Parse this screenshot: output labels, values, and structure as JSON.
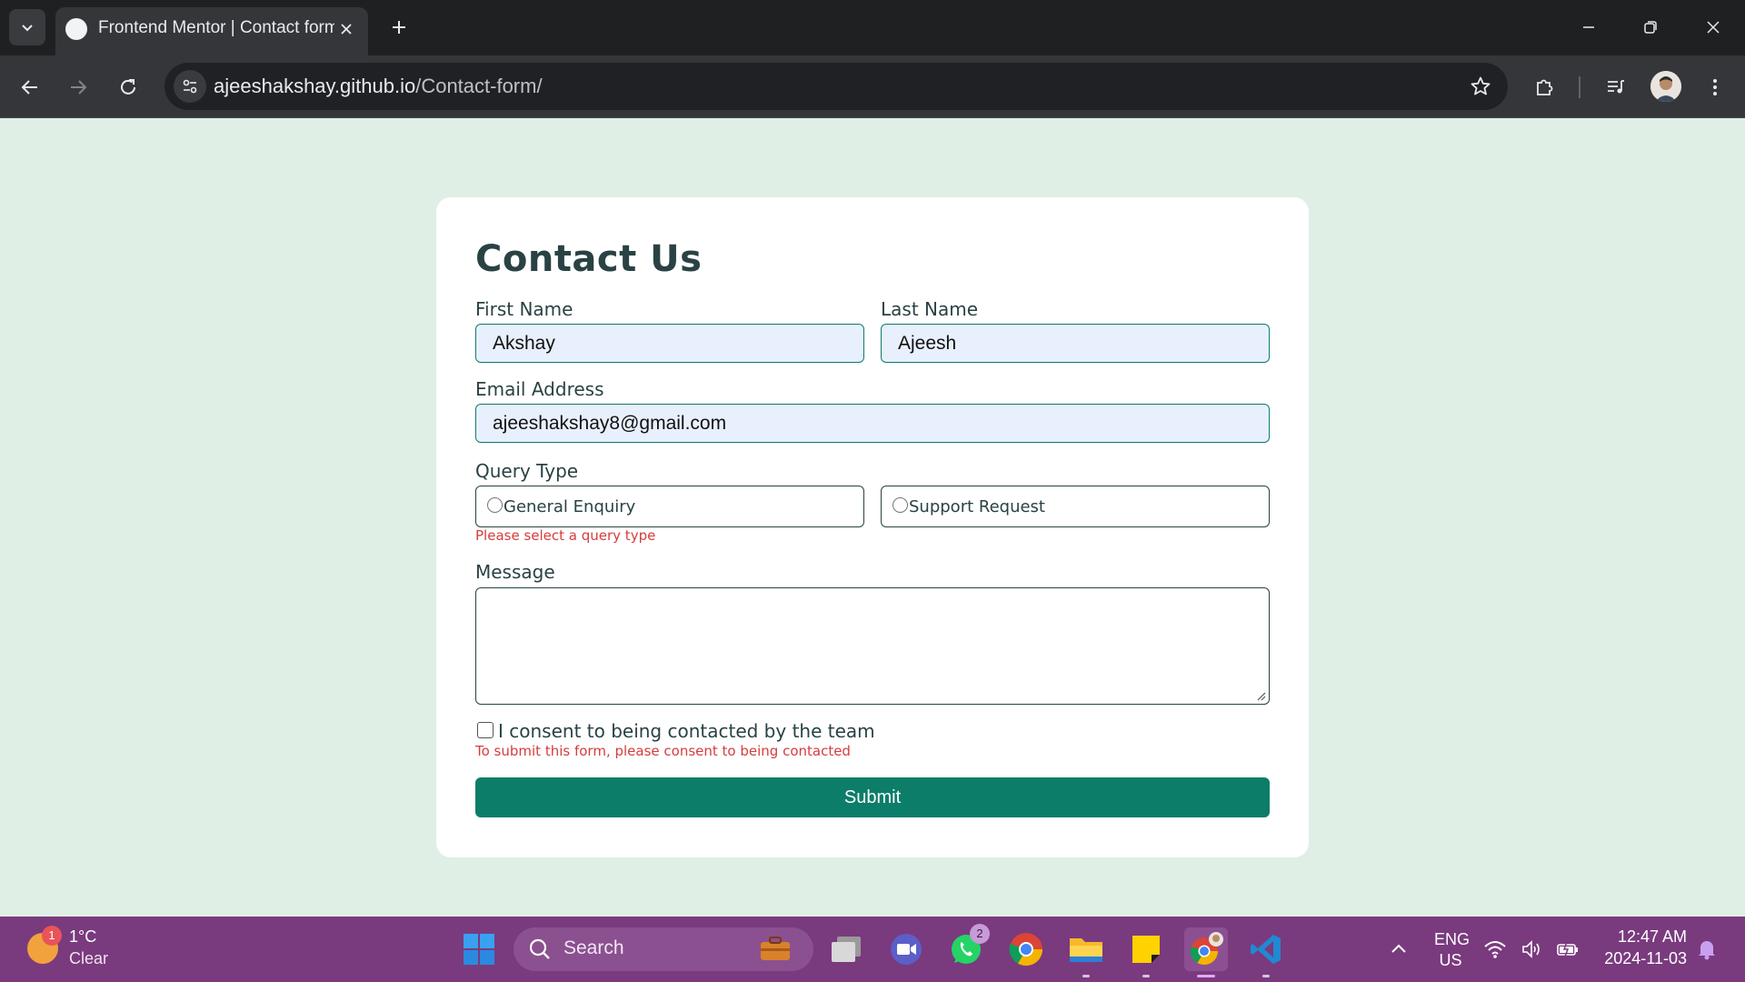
{
  "browser": {
    "tab_title": "Frontend Mentor | Contact form",
    "url_host": "ajeeshakshay.github.io",
    "url_path": "/Contact-form/"
  },
  "form": {
    "title": "Contact Us",
    "first_name_label": "First Name",
    "first_name_value": "Akshay",
    "last_name_label": "Last Name",
    "last_name_value": "Ajeesh",
    "email_label": "Email Address",
    "email_value": "ajeeshakshay8@gmail.com",
    "query_label": "Query Type",
    "query_options": [
      "General Enquiry",
      "Support Request"
    ],
    "query_error": "Please select a query type",
    "message_label": "Message",
    "message_value": "",
    "consent_label": "I consent to being contacted by the team",
    "consent_error": "To submit this form, please consent to being contacted",
    "submit_label": "Submit"
  },
  "colors": {
    "page_bg": "#dfefe5",
    "accent": "#0c7d69",
    "error": "#d73c3c",
    "taskbar": "#7a3a7e"
  },
  "taskbar": {
    "weather_badge": "1",
    "temperature": "1°C",
    "condition": "Clear",
    "search_placeholder": "Search",
    "whatsapp_badge": "2",
    "lang_line1": "ENG",
    "lang_line2": "US",
    "time": "12:47 AM",
    "date": "2024-11-03",
    "apps": [
      "windows-start",
      "search",
      "work-briefcase",
      "task-view",
      "zoom",
      "whatsapp",
      "chrome",
      "file-explorer",
      "sticky-notes",
      "chrome-profile",
      "vscode"
    ]
  }
}
